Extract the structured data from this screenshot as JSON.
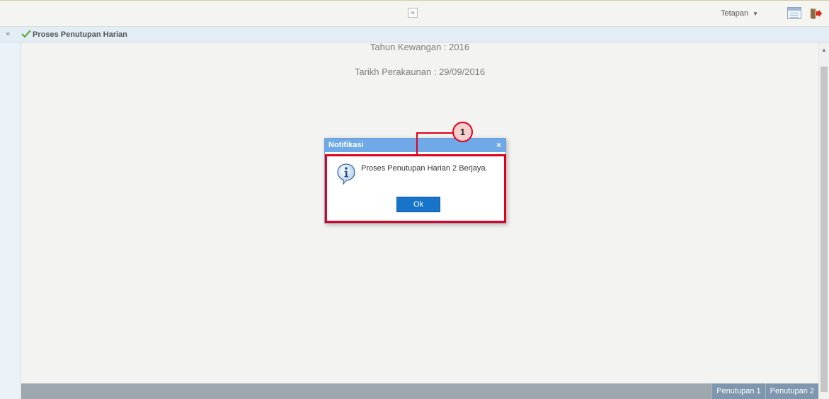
{
  "topbar": {
    "collapse_glyph": "≈",
    "settings_label": "Tetapan",
    "settings_caret": "▼"
  },
  "tab": {
    "expand_glyph": "»",
    "title": "Proses Penutupan Harian"
  },
  "content": {
    "line1": "Tahun Kewangan : 2016",
    "line2": "Tarikh Perakaunan : 29/09/2016"
  },
  "dialog": {
    "title": "Notifikasi",
    "close_glyph": "×",
    "message": "Proses Penutupan Harian 2 Berjaya.",
    "ok_label": "Ok"
  },
  "annotation": {
    "step": "1"
  },
  "bottom_tabs": [
    {
      "label": "Penutupan 1"
    },
    {
      "label": "Penutupan 2"
    }
  ],
  "colors": {
    "dialog_header": "#6fa9e8",
    "ok_button": "#1874c9",
    "highlight": "#e1001a"
  }
}
